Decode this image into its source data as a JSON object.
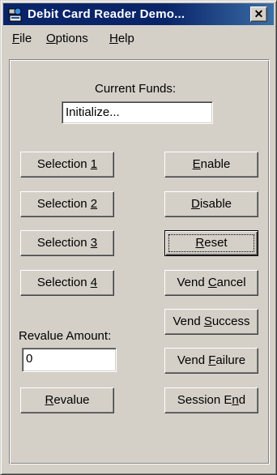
{
  "window": {
    "title": "Debit Card Reader Demo...",
    "close_glyph": "✕",
    "icon": "card-reader-app-icon"
  },
  "menu": [
    {
      "label": "File",
      "mnemonic": "F"
    },
    {
      "label": "Options",
      "mnemonic": "O"
    },
    {
      "label": "Help",
      "mnemonic": "H"
    }
  ],
  "funds": {
    "label": "Current Funds:",
    "value": "Initialize..."
  },
  "selections": [
    {
      "prefix": "Selection ",
      "key": "1"
    },
    {
      "prefix": "Selection ",
      "key": "2"
    },
    {
      "prefix": "Selection ",
      "key": "3"
    },
    {
      "prefix": "Selection ",
      "key": "4"
    }
  ],
  "actions": [
    {
      "pre": "",
      "key": "E",
      "post": "nable"
    },
    {
      "pre": "",
      "key": "D",
      "post": "isable"
    },
    {
      "pre": "",
      "key": "R",
      "post": "eset",
      "default": true
    },
    {
      "pre": "Vend ",
      "key": "C",
      "post": "ancel"
    },
    {
      "pre": "Vend ",
      "key": "S",
      "post": "uccess"
    },
    {
      "pre": "Vend ",
      "key": "F",
      "post": "ailure"
    },
    {
      "pre": "Session E",
      "key": "n",
      "post": "d"
    }
  ],
  "revalue": {
    "label": "Revalue Amount:",
    "value": "0",
    "button": {
      "pre": "",
      "key": "R",
      "post": "evalue"
    }
  },
  "colors": {
    "face": "#d4d0c8",
    "title_bar": "#0a246a",
    "title_text": "#ffffff"
  }
}
